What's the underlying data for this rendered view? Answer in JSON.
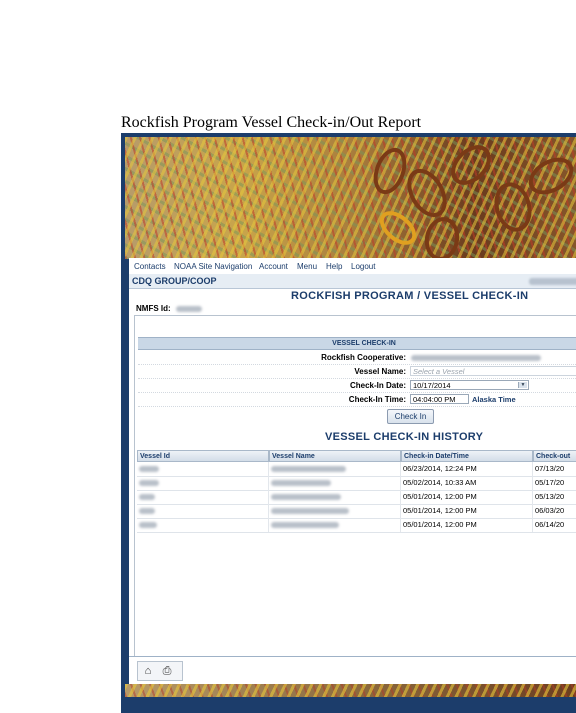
{
  "document": {
    "title": "Rockfish Program Vessel Check-in/Out Report"
  },
  "nav": {
    "items": [
      "Contacts",
      "NOAA Site Navigation",
      "Account",
      "Menu",
      "Help",
      "Logout"
    ]
  },
  "group_bar": {
    "title": "CDQ GROUP/COOP"
  },
  "page": {
    "heading": "ROCKFISH PROGRAM / VESSEL CHECK-IN",
    "nmfs_label": "NMFS Id:"
  },
  "checkin": {
    "panel_title": "VESSEL CHECK-IN",
    "coop_label": "Rockfish Cooperative:",
    "vessel_label": "Vessel Name:",
    "vessel_placeholder": "Select a Vessel",
    "date_label": "Check-In Date:",
    "date_value": "10/17/2014",
    "time_label": "Check-In Time:",
    "time_value": "04:04:00 PM",
    "time_zone": "Alaska Time",
    "button": "Check In"
  },
  "history": {
    "title": "VESSEL CHECK-IN HISTORY",
    "columns": [
      "Vessel Id",
      "Vessel Name",
      "Check-in Date/Time",
      "Check-out"
    ],
    "rows": [
      {
        "checkin": "06/23/2014, 12:24 PM",
        "checkout": "07/13/20"
      },
      {
        "checkin": "05/02/2014, 10:33 AM",
        "checkout": "05/17/20"
      },
      {
        "checkin": "05/01/2014, 12:00 PM",
        "checkout": "05/13/20"
      },
      {
        "checkin": "05/01/2014, 12:00 PM",
        "checkout": "06/03/20"
      },
      {
        "checkin": "05/01/2014, 12:00 PM",
        "checkout": "06/14/20"
      }
    ]
  },
  "footer": {
    "icons": [
      "home-icon",
      "print-icon"
    ]
  }
}
